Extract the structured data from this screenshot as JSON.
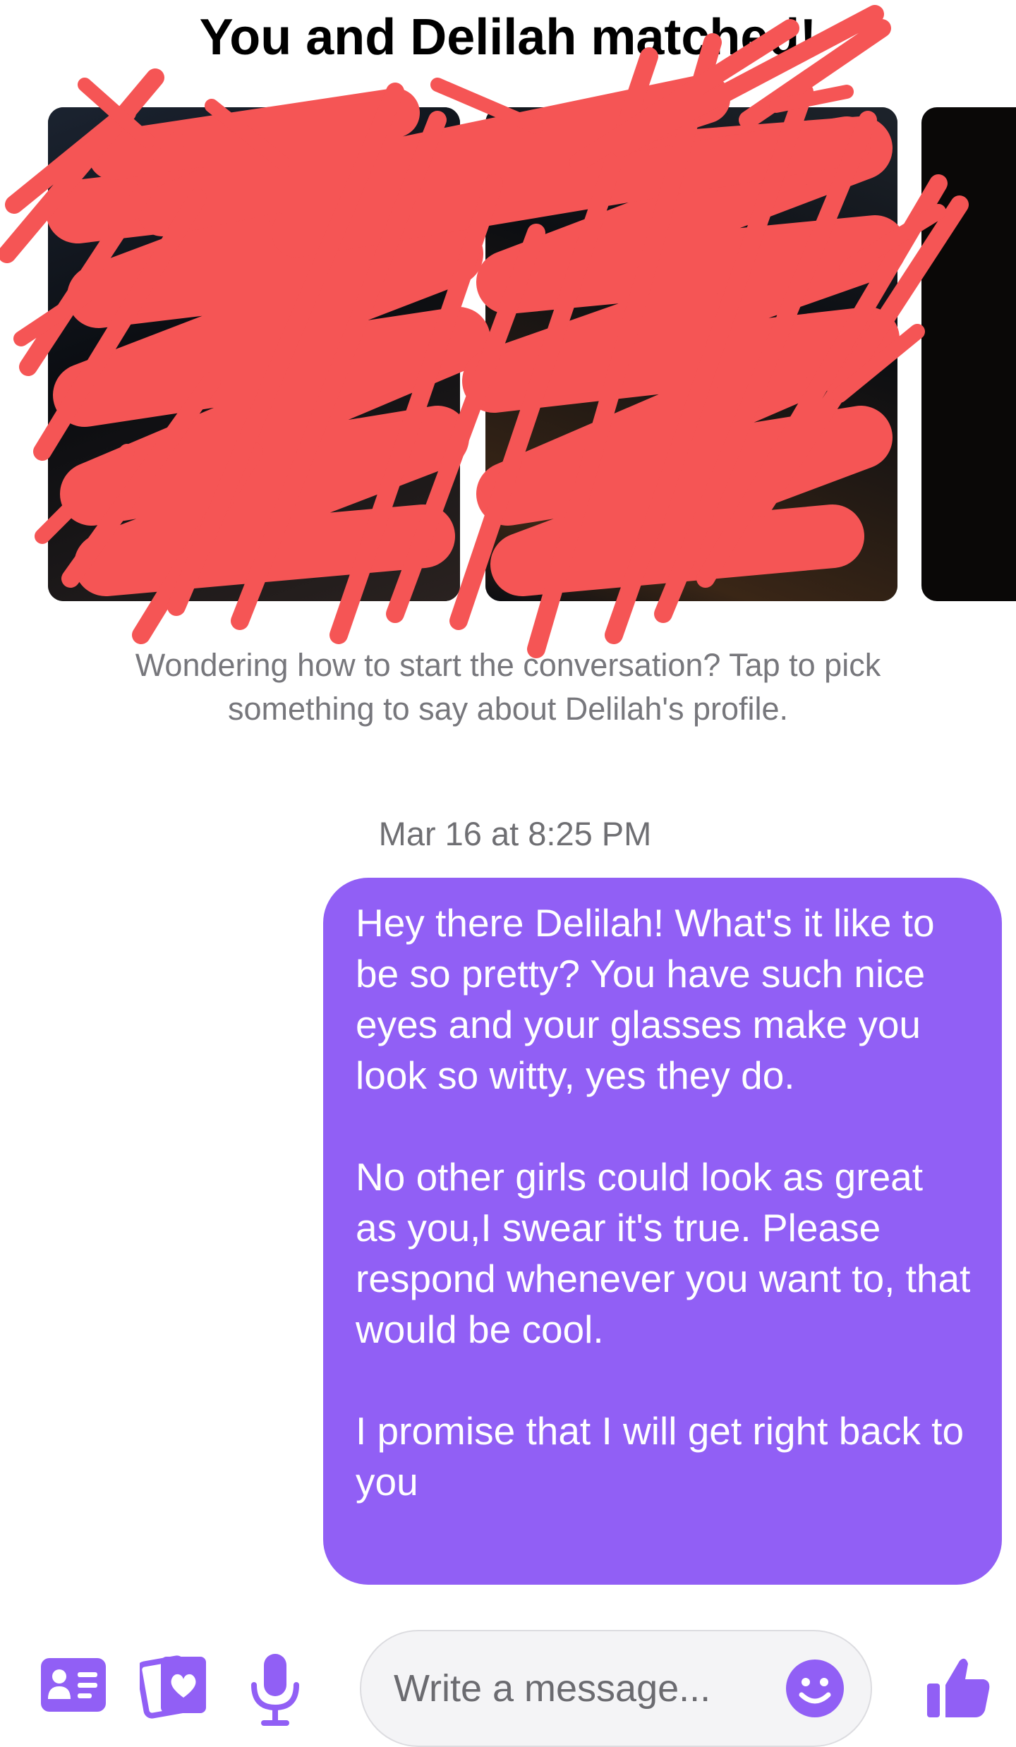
{
  "header": {
    "title": "You and Delilah matched!"
  },
  "profile_photos": {
    "count_visible": 3,
    "redacted": true,
    "redaction_color": "#f55555"
  },
  "conversation_prompt": "Wondering how to start the conversation? Tap to pick something to say about Delilah's profile.",
  "messages": [
    {
      "timestamp": "Mar 16 at 8:25 PM",
      "direction": "outgoing",
      "text": "Hey there Delilah! What's it like to be so pretty? You have such nice eyes and your glasses make you look so witty, yes they do.\n\nNo other girls could look as great as you,I swear it's true. Please respond whenever you want to, that would be cool.\n\nI promise that I will get right back to you"
    }
  ],
  "composer": {
    "placeholder": "Write a message...",
    "value": "",
    "icons": [
      "profile-card-icon",
      "photo-heart-icon",
      "microphone-icon",
      "emoji-icon",
      "thumbs-up-icon"
    ]
  },
  "colors": {
    "accent": "#915ff5",
    "bubble_text": "#ffffff",
    "muted_text": "#77777c",
    "scribble": "#f55555"
  }
}
